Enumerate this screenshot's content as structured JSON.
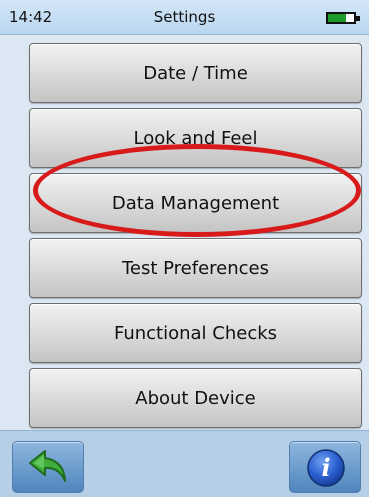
{
  "status_bar": {
    "time": "14:42",
    "title": "Settings",
    "battery_level": 0.7
  },
  "menu": {
    "items": [
      {
        "label": "Date / Time"
      },
      {
        "label": "Look and Feel"
      },
      {
        "label": "Data Management",
        "highlighted": true
      },
      {
        "label": "Test Preferences"
      },
      {
        "label": "Functional Checks"
      },
      {
        "label": "About Device"
      }
    ],
    "highlight_color": "#d81a1a"
  },
  "bottom_bar": {
    "back_icon": "back-arrow-icon",
    "info_icon": "info-icon",
    "info_glyph": "i"
  }
}
